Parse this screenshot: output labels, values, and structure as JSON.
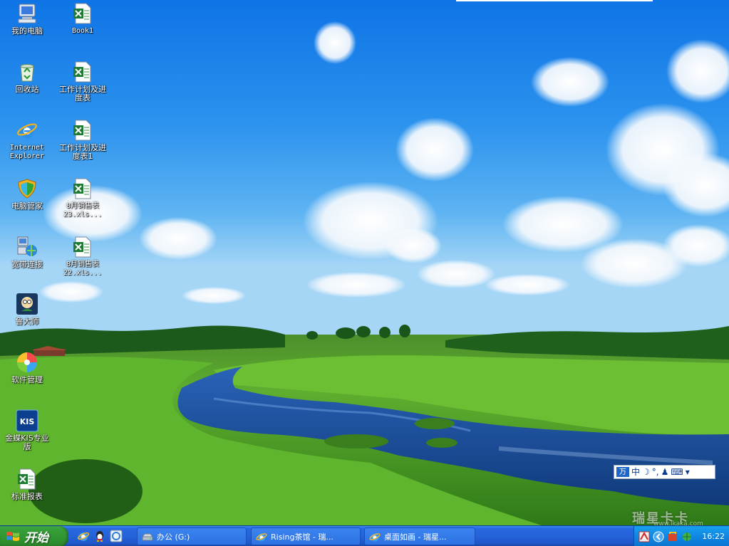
{
  "desktop": {
    "icons": [
      {
        "label": "我的电脑",
        "icon": "my-computer-icon"
      },
      {
        "label": "Book1",
        "icon": "excel-file-icon"
      },
      {
        "label": "回收站",
        "icon": "recycle-bin-icon"
      },
      {
        "label": "工作计划及进\n度表",
        "icon": "excel-file-icon"
      },
      {
        "label": "Internet\nExplorer",
        "icon": "internet-explorer-icon"
      },
      {
        "label": "工作计划及进\n度表1",
        "icon": "excel-file-icon"
      },
      {
        "label": "电脑管家",
        "icon": "shield-icon"
      },
      {
        "label": "8月销售表\n23.xls...",
        "icon": "excel-file-icon"
      },
      {
        "label": "宽带连接",
        "icon": "network-connection-icon"
      },
      {
        "label": "8月销售表\n22.xls...",
        "icon": "excel-file-icon"
      },
      {
        "label": "鲁大师",
        "icon": "ludashi-icon"
      },
      {
        "label": "软件管理",
        "icon": "software-manager-icon"
      },
      {
        "label": "金蝶KIS专业\n版",
        "icon": "kis-icon"
      },
      {
        "label": "标准报表",
        "icon": "excel-file-icon"
      }
    ]
  },
  "ime": {
    "logo": "万",
    "mode": "中",
    "moon": "☽",
    "punct": "°,",
    "person": "♟",
    "keyboard": "⌨",
    "menu": "▾"
  },
  "watermark": {
    "text": "瑞星卡卡",
    "sub": "www.ikaka.com"
  },
  "taskbar": {
    "start_label": "开始",
    "tasks": [
      {
        "label": "办公 (G:)",
        "icon": "drive-icon"
      },
      {
        "label": "Rising茶馆 - 瑞...",
        "icon": "internet-explorer-icon"
      },
      {
        "label": "桌面如画 - 瑞星...",
        "icon": "internet-explorer-icon"
      }
    ],
    "clock": "16:22"
  },
  "colors": {
    "taskbar": "#2563d9",
    "start": "#37a03a",
    "tray": "#0f87e2"
  }
}
